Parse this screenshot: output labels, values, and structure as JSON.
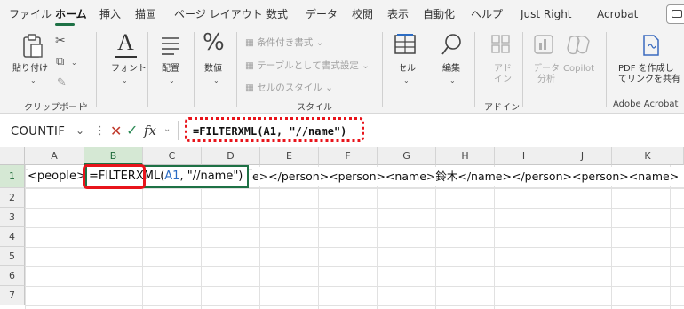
{
  "tabs": [
    "ファイル",
    "ホーム",
    "挿入",
    "描画",
    "ページ レイアウト",
    "数式",
    "データ",
    "校閲",
    "表示",
    "自動化",
    "ヘルプ",
    "Just Right",
    "Acrobat"
  ],
  "ribbon": {
    "paste_label": "貼り付け",
    "clipboard_label": "クリップボード",
    "font_label": "フォント",
    "align_label": "配置",
    "number_label": "数値",
    "cond_format": "条件付き書式",
    "table_format": "テーブルとして書式設定",
    "cell_style": "セルのスタイル",
    "style_group": "スタイル",
    "cells_label": "セル",
    "edit_label": "編集",
    "addin_label": "アド\nイン",
    "addin_group": "アドイン",
    "data_analysis": "データ\n分析",
    "copilot": "Copilot",
    "pdf_label": "PDF を作成し\nてリンクを共有",
    "adobe_group": "Adobe Acrobat"
  },
  "formula_bar": {
    "name_box": "COUNTIF",
    "fx": "fx",
    "formula": "=FILTERXML(A1, \"//name\")"
  },
  "grid": {
    "columns": [
      "A",
      "B",
      "C",
      "D",
      "E",
      "F",
      "G",
      "H",
      "I",
      "J",
      "K"
    ],
    "rows": [
      "1",
      "2",
      "3",
      "4",
      "5",
      "6",
      "7"
    ],
    "a1_text": "<people>",
    "b1_prefix": "=FILTERXML(",
    "b1_ref": "A1",
    "b1_suffix": ", \"//name\")",
    "overflow_text": "e></person><person><name>鈴木</name></person><person><name>"
  },
  "colors": {
    "accent": "#1e7145",
    "highlight": "#e8141b",
    "cell_ref": "#2b6cc4"
  }
}
